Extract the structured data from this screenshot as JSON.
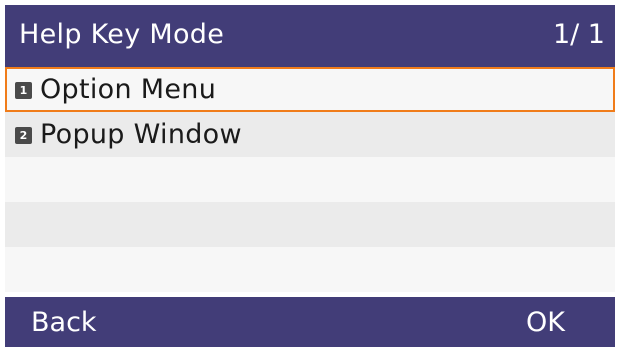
{
  "header": {
    "title": "Help Key Mode",
    "page_indicator": "1/ 1"
  },
  "menu": {
    "items": [
      {
        "number": "1",
        "label": "Option Menu",
        "selected": true
      },
      {
        "number": "2",
        "label": "Popup Window",
        "selected": false
      }
    ]
  },
  "softkeys": {
    "back_label": "Back",
    "ok_label": "OK"
  },
  "colors": {
    "bar_background": "#423d78",
    "selection_border": "#f07c1a",
    "row_light": "#f7f7f7",
    "row_dark": "#ebebeb"
  }
}
